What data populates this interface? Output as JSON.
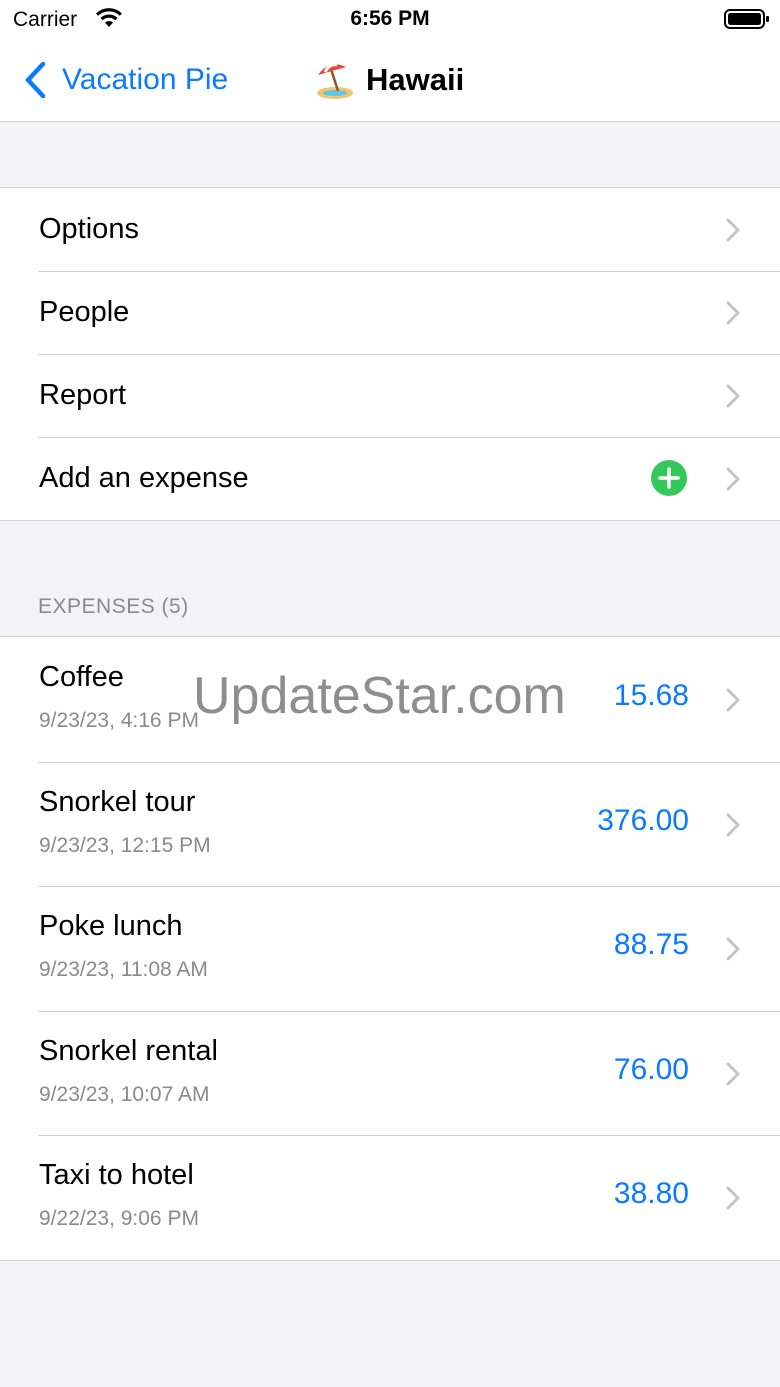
{
  "status_bar": {
    "carrier": "Carrier",
    "time": "6:56 PM",
    "wifi_icon": "wifi-icon",
    "battery_icon": "battery-icon"
  },
  "nav": {
    "back_label": "Vacation Pie",
    "title_emoji_icon": "beach-umbrella-icon",
    "title": "Hawaii"
  },
  "menu": {
    "items": [
      {
        "label": "Options"
      },
      {
        "label": "People"
      },
      {
        "label": "Report"
      },
      {
        "label": "Add an expense",
        "icon": "plus-circle-icon"
      }
    ]
  },
  "expenses": {
    "header": "EXPENSES (5)",
    "items": [
      {
        "name": "Coffee",
        "date": "9/23/23, 4:16 PM",
        "amount": "15.68"
      },
      {
        "name": "Snorkel tour",
        "date": "9/23/23, 12:15 PM",
        "amount": "376.00"
      },
      {
        "name": "Poke lunch",
        "date": "9/23/23, 11:08 AM",
        "amount": "88.75"
      },
      {
        "name": "Snorkel rental",
        "date": "9/23/23, 10:07 AM",
        "amount": "76.00"
      },
      {
        "name": "Taxi to hotel",
        "date": "9/22/23, 9:06 PM",
        "amount": "38.80"
      }
    ]
  },
  "watermark": "UpdateStar.com",
  "colors": {
    "accent": "#0a7aff",
    "add_button": "#34c759",
    "background": "#f2f2f7",
    "secondary_text": "#8a8a8e"
  }
}
